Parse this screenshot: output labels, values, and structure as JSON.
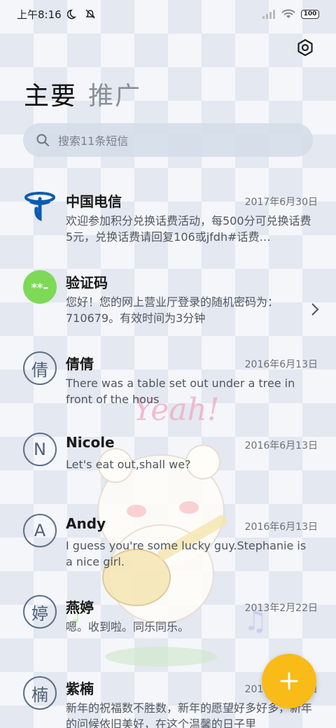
{
  "status_bar": {
    "time": "上午8:16",
    "battery": "100"
  },
  "tabs": [
    {
      "label": "主要"
    },
    {
      "label": "推广"
    }
  ],
  "search": {
    "placeholder": "搜索11条短信"
  },
  "conversations": [
    {
      "avatar": "",
      "name": "中国电信",
      "date": "2017年6月30日",
      "preview": "欢迎参加积分兑换话费活动，每500分可兑换话费5元，兑换话费请回复106或jfdh#话费…"
    },
    {
      "avatar": "**–",
      "name": "验证码",
      "date": "",
      "preview": "您好！您的网上营业厅登录的随机密码为：710679。有效时间为3分钟"
    },
    {
      "avatar": "倩",
      "name": "倩倩",
      "date": "2016年6月13日",
      "preview": "There was a table set out under a tree in front of the hous"
    },
    {
      "avatar": "N",
      "name": "Nicole",
      "date": "2016年6月13日",
      "preview": "Let's eat out,shall we?"
    },
    {
      "avatar": "A",
      "name": "Andy",
      "date": "2016年6月13日",
      "preview": "I guess you're some lucky guy.Stephanie is a nice girl."
    },
    {
      "avatar": "婷",
      "name": "燕婷",
      "date": "2013年2月22日",
      "preview": "嗯。收到啦。同乐同乐。"
    },
    {
      "avatar": "楠",
      "name": "紫楠",
      "date": "2013年2月22日",
      "preview": "新年的祝福数不胜数，新年的愿望好多好多，新年的问候依旧美好，在这个温馨的日子里"
    }
  ],
  "wallpaper_text": "Yeah!",
  "colors": {
    "fab": "#f8bb17",
    "telecom_blue": "#0b5cad",
    "otp_green": "#7ed957"
  },
  "icons": {
    "settings": "gear-icon",
    "search": "search-icon",
    "compose": "plus-icon",
    "chevron": "chevron-right-icon"
  }
}
